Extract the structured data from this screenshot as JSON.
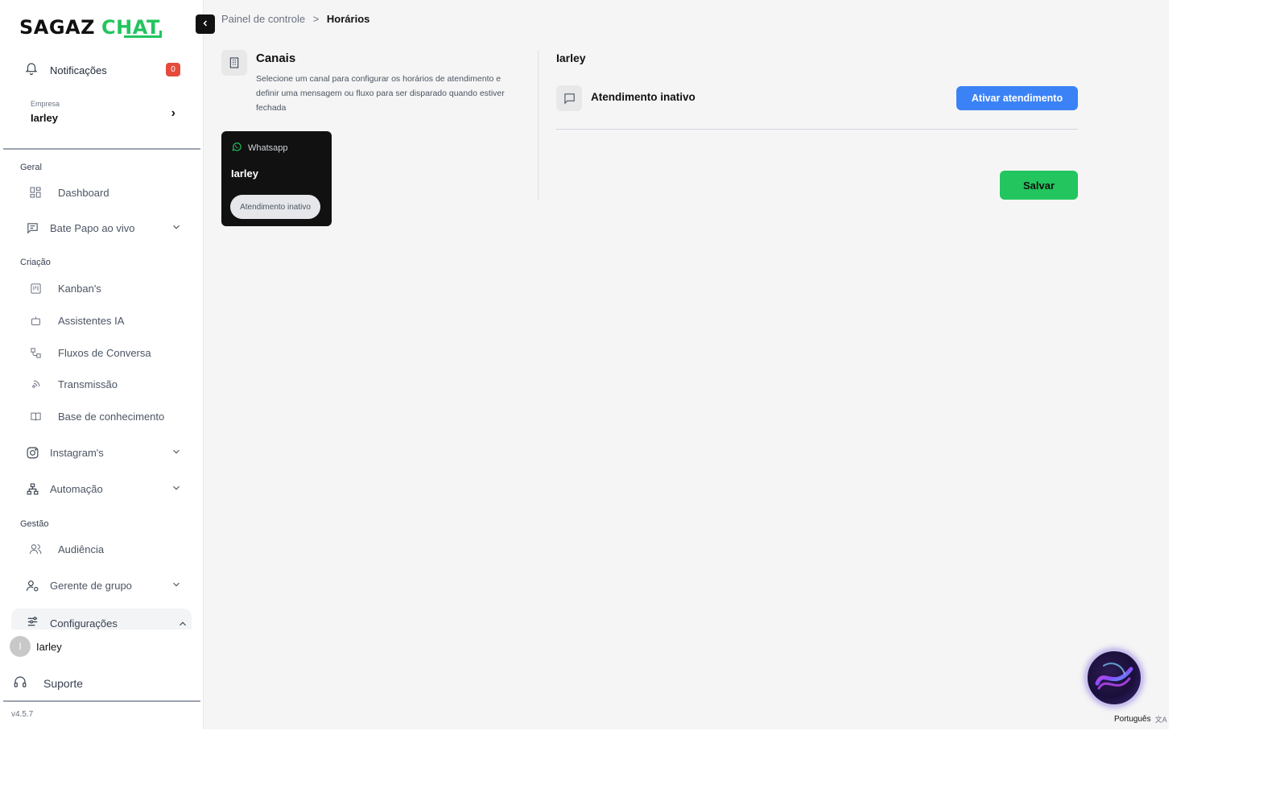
{
  "brand": {
    "name_part1": "SAGAZ",
    "name_part2": "CHAT",
    "accent": "#22c55e"
  },
  "sidebar": {
    "notifications": {
      "label": "Notificações",
      "count": "0"
    },
    "company": {
      "caption": "Empresa",
      "name": "Iarley"
    },
    "sections": {
      "geral": "Geral",
      "criacao": "Criação",
      "gestao": "Gestão"
    },
    "items": {
      "dashboard": "Dashboard",
      "bate_papo": "Bate Papo ao vivo",
      "kanban": "Kanban's",
      "assistentes": "Assistentes IA",
      "fluxos": "Fluxos de Conversa",
      "transmissao": "Transmissão",
      "base": "Base de conhecimento",
      "instagram": "Instagram's",
      "automacao": "Automação",
      "audiencia": "Audiência",
      "gerente": "Gerente de grupo",
      "configuracoes": "Configurações"
    },
    "user": {
      "initial": "I",
      "name": "Iarley"
    },
    "support": "Suporte",
    "version": "v4.5.7"
  },
  "breadcrumb": {
    "parent": "Painel de controle",
    "separator": ">",
    "current": "Horários"
  },
  "channels_panel": {
    "title": "Canais",
    "description": "Selecione um canal para configurar os horários de atendimento e definir uma mensagem ou fluxo para ser disparado quando estiver fechada",
    "card": {
      "channel": "Whatsapp",
      "name": "Iarley",
      "status": "Atendimento inativo"
    }
  },
  "detail": {
    "title": "Iarley",
    "status": "Atendimento inativo",
    "activate_label": "Ativar atendimento",
    "save_label": "Salvar"
  },
  "language": "Português",
  "colors": {
    "primary_blue": "#3b82f6",
    "save_green": "#22c55e",
    "badge_red": "#e54b3c",
    "card_bg": "#111111"
  }
}
